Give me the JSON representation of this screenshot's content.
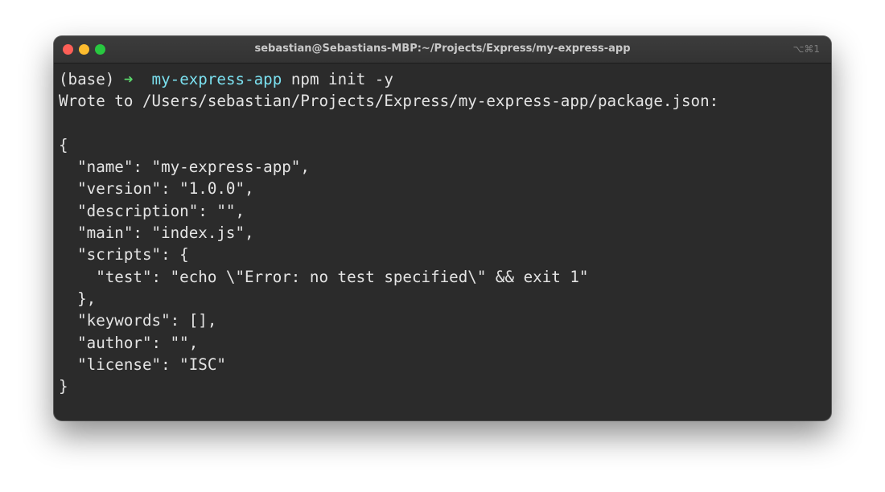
{
  "window": {
    "title": "sebastian@Sebastians-MBP:~/Projects/Express/my-express-app",
    "shortcut": "⌥⌘1"
  },
  "prompt": {
    "env": "(base)",
    "arrow": "➜",
    "directory": "my-express-app",
    "command": "npm init -y"
  },
  "output": [
    "Wrote to /Users/sebastian/Projects/Express/my-express-app/package.json:",
    "",
    "{",
    "  \"name\": \"my-express-app\",",
    "  \"version\": \"1.0.0\",",
    "  \"description\": \"\",",
    "  \"main\": \"index.js\",",
    "  \"scripts\": {",
    "    \"test\": \"echo \\\"Error: no test specified\\\" && exit 1\"",
    "  },",
    "  \"keywords\": [],",
    "  \"author\": \"\",",
    "  \"license\": \"ISC\"",
    "}"
  ],
  "colors": {
    "terminal_bg": "#2b2b2b",
    "text": "#e4e4e4",
    "prompt_arrow": "#5ad66b",
    "prompt_dir": "#7be0ef",
    "close": "#fe5f57",
    "minimize": "#febc2e",
    "maximize": "#28c840"
  }
}
